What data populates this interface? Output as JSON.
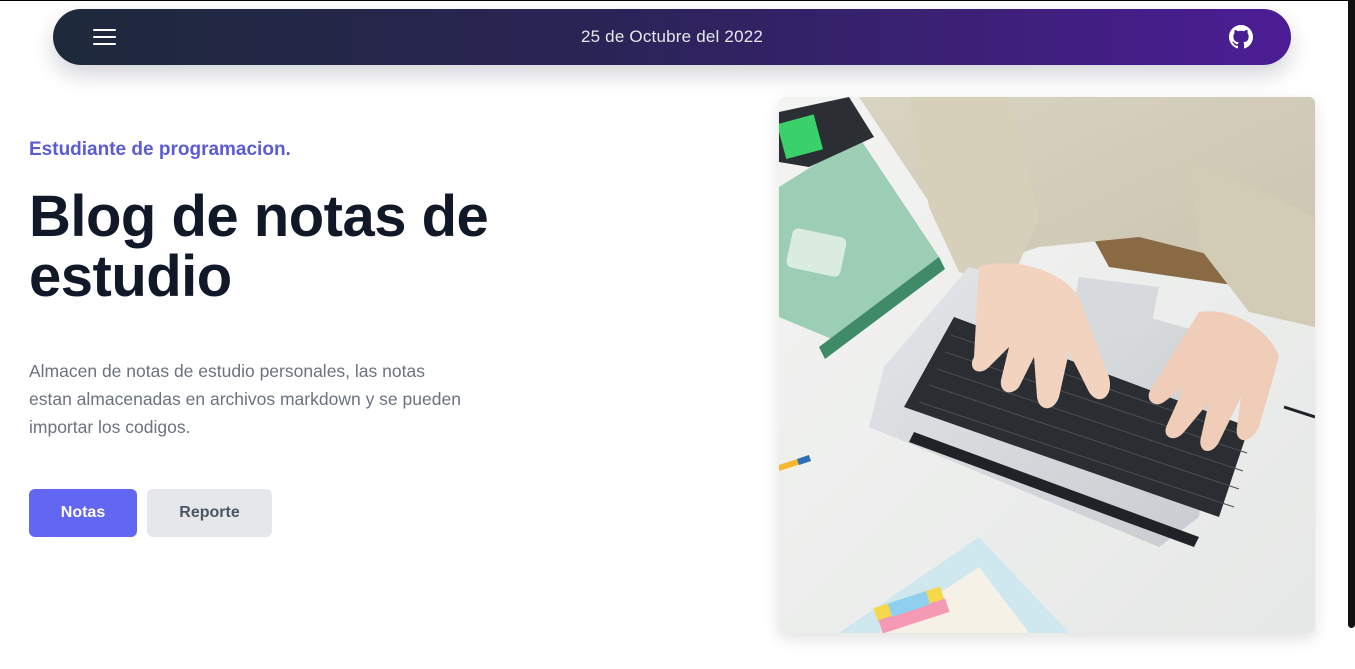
{
  "navbar": {
    "date": "25 de Octubre del 2022",
    "menu_icon": "hamburger-menu-icon",
    "github_icon": "github-icon",
    "gradient": [
      "#1e293b",
      "#4c1d95"
    ]
  },
  "hero": {
    "subtitle": "Estudiante de programacion.",
    "title": "Blog de notas de estudio",
    "description": "Almacen de notas de estudio personales, las notas estan almacenadas en archivos markdown y se pueden importar los codigos.",
    "buttons": {
      "primary": "Notas",
      "secondary": "Reporte"
    },
    "image": "laptop-typing-photo"
  },
  "colors": {
    "accent": "#6366f1",
    "subtitle": "#5b5bd6",
    "title": "#111827",
    "text": "#6b7280",
    "secondary_button": "#e5e7eb"
  }
}
